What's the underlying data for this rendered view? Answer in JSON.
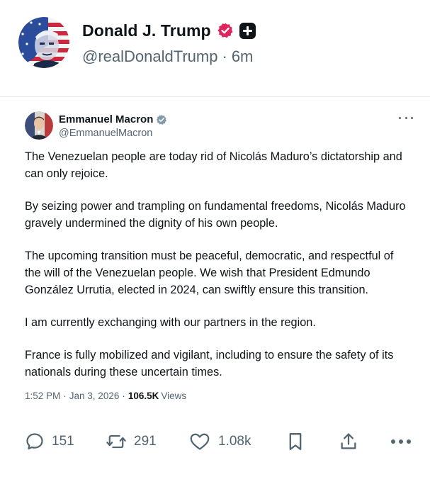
{
  "outer_post": {
    "author_name": "Donald J. Trump",
    "handle": "@realDonaldTrump",
    "separator": "·",
    "time_ago": "6m",
    "verified_icon": "verified-badge-pink",
    "extra_badge_icon": "plus-icon"
  },
  "embedded_post": {
    "author_name": "Emmanuel Macron",
    "handle": "@EmmanuelMacron",
    "verified_icon": "verified-badge-gray",
    "paragraphs": [
      "The Venezuelan people are today rid of Nicolás Maduro’s dictatorship and can only rejoice.",
      "By seizing power and trampling on fundamental freedoms, Nicolás Maduro gravely undermined the dignity of his own people.",
      "The upcoming transition must be peaceful, democratic, and respectful of the will of the Venezuelan people. We wish that President Edmundo González Urrutia, elected in 2024, can swiftly ensure this transition.",
      "I am currently exchanging with our partners in the region.",
      "France is fully mobilized and vigilant, including to ensure the safety of its nationals during these uncertain times."
    ],
    "time": "1:52 PM",
    "date": "Jan 3, 2026",
    "sep": "·",
    "views_count": "106.5K",
    "views_label": "Views"
  },
  "actions": {
    "replies": "151",
    "reposts": "291",
    "likes": "1.08k"
  },
  "colors": {
    "text_primary": "#0f1419",
    "text_secondary": "#536471",
    "verified_pink": "#e0245e",
    "verified_gray": "#829aab"
  }
}
